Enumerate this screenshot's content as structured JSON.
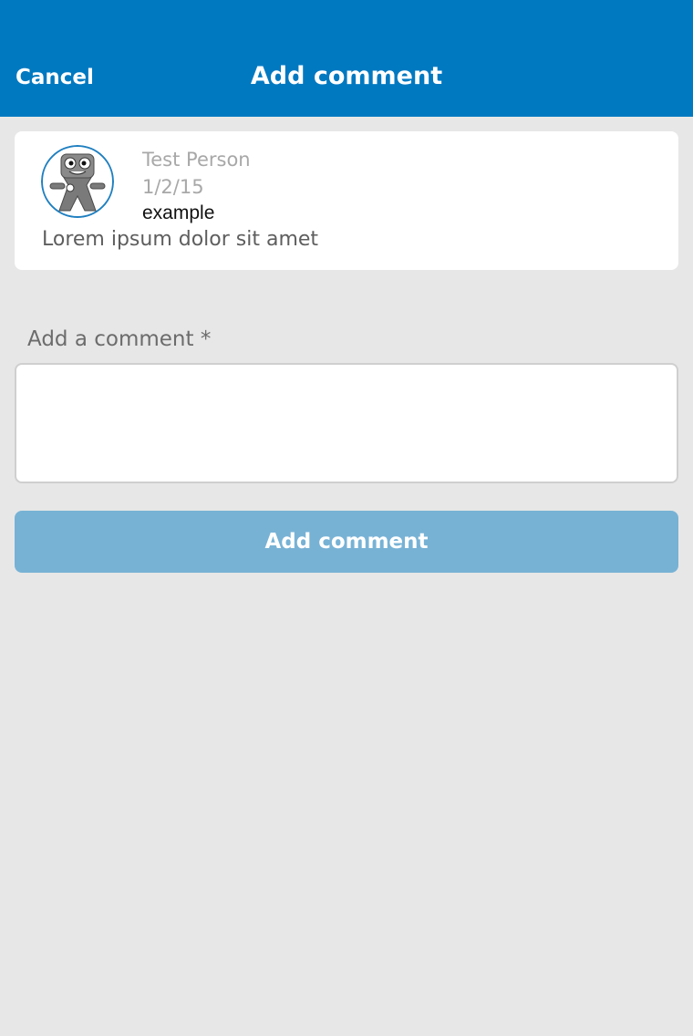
{
  "header": {
    "cancel_label": "Cancel",
    "title": "Add comment",
    "background_color": "#0079c1"
  },
  "post": {
    "avatar_icon": "robot-mascot-avatar",
    "author": "Test Person",
    "date": "1/2/15",
    "tag": "example",
    "body": "Lorem ipsum dolor sit amet"
  },
  "comment_form": {
    "label": "Add a comment *",
    "value": "",
    "placeholder": "",
    "submit_label": "Add comment",
    "submit_color": "#77b2d5",
    "submit_disabled": true
  }
}
